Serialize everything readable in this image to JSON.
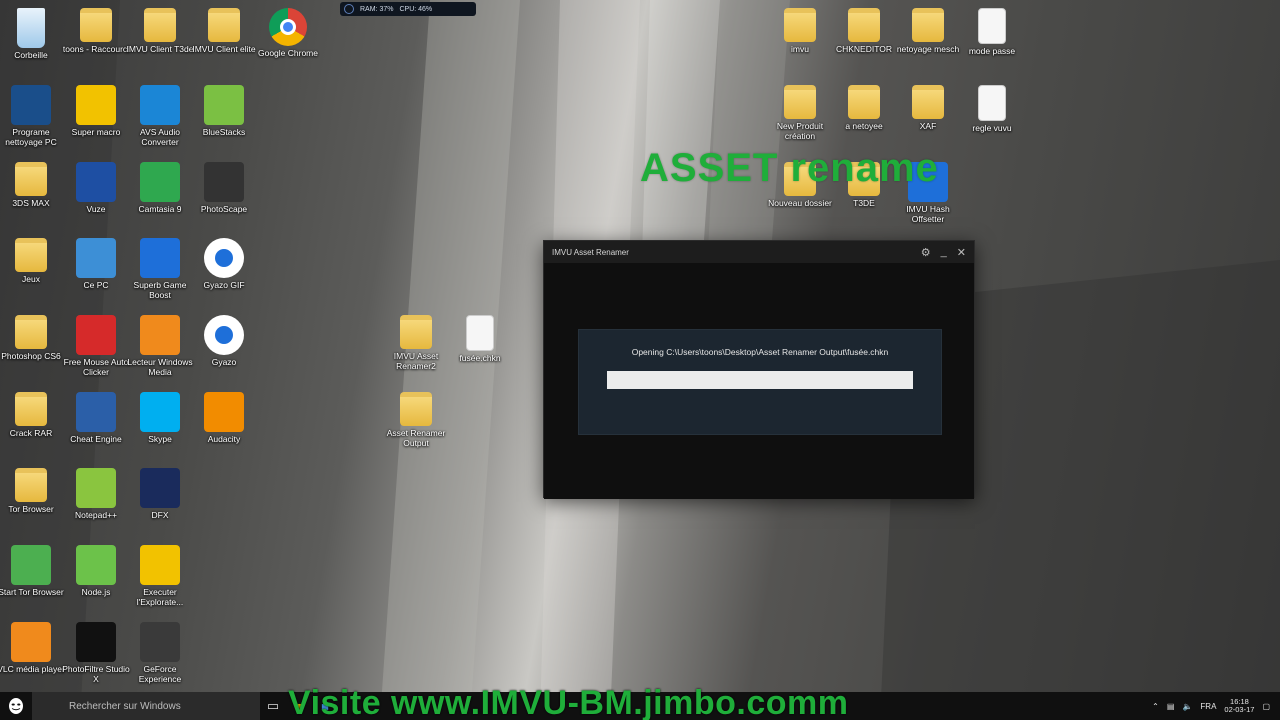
{
  "desktop_icons": [
    {
      "label": "Corbeille",
      "icon": "recycle-bin-icon",
      "type": "bin",
      "color": "#8fc7ee"
    },
    {
      "label": "toons - Raccourci",
      "icon": "folder-shortcut-icon",
      "type": "folder"
    },
    {
      "label": "IMVU Client T3de",
      "icon": "folder-icon",
      "type": "folder"
    },
    {
      "label": "IMVU Client elite",
      "icon": "folder-icon",
      "type": "folder"
    },
    {
      "label": "Google Chrome",
      "icon": "chrome-icon",
      "type": "chrome"
    },
    {
      "label": "Programe nettoyage PC",
      "icon": "cleaner-icon",
      "type": "app",
      "color": "#1a4e8a"
    },
    {
      "label": "Super macro",
      "icon": "macro-icon",
      "type": "app",
      "color": "#f2c200"
    },
    {
      "label": "AVS Audio Converter",
      "icon": "audio-converter-icon",
      "type": "app",
      "color": "#1b86d6"
    },
    {
      "label": "BlueStacks",
      "icon": "bluestacks-icon",
      "type": "app",
      "color": "#7bc043"
    },
    {
      "label": "3DS MAX",
      "icon": "3dsmax-icon",
      "type": "folder"
    },
    {
      "label": "Vuze",
      "icon": "vuze-icon",
      "type": "app",
      "color": "#1e4fa3"
    },
    {
      "label": "Camtasia 9",
      "icon": "camtasia-icon",
      "type": "app",
      "color": "#2fa84f"
    },
    {
      "label": "PhotoScape",
      "icon": "photoscape-icon",
      "type": "app",
      "color": "#333333"
    },
    {
      "label": "Jeux",
      "icon": "folder-icon",
      "type": "folder"
    },
    {
      "label": "Ce PC",
      "icon": "computer-icon",
      "type": "app",
      "color": "#3d8fd6"
    },
    {
      "label": "Superb Game Boost",
      "icon": "rocket-icon",
      "type": "app",
      "color": "#1e6fd9"
    },
    {
      "label": "Gyazo GIF",
      "icon": "gyazo-gif-icon",
      "type": "app",
      "color": "#ffffff"
    },
    {
      "label": "Photoshop CS6",
      "icon": "folder-icon",
      "type": "folder"
    },
    {
      "label": "Free Mouse Auto Clicker",
      "icon": "ruby-icon",
      "type": "app",
      "color": "#d62a2a"
    },
    {
      "label": "Lecteur Windows Media",
      "icon": "media-player-icon",
      "type": "app",
      "color": "#f08a1c"
    },
    {
      "label": "Gyazo",
      "icon": "gyazo-icon",
      "type": "app",
      "color": "#ffffff"
    },
    {
      "label": "Crack RAR",
      "icon": "folder-icon",
      "type": "folder"
    },
    {
      "label": "Cheat Engine",
      "icon": "cheat-engine-icon",
      "type": "app",
      "color": "#2b5fa8"
    },
    {
      "label": "Skype",
      "icon": "skype-icon",
      "type": "app",
      "color": "#00aff0"
    },
    {
      "label": "Audacity",
      "icon": "audacity-icon",
      "type": "app",
      "color": "#f28c00"
    },
    {
      "label": "Tor Browser",
      "icon": "tor-icon",
      "type": "folder"
    },
    {
      "label": "Notepad++",
      "icon": "notepad-plus-icon",
      "type": "app",
      "color": "#8ac53f"
    },
    {
      "label": "DFX",
      "icon": "dfx-icon",
      "type": "app",
      "color": "#1a2b5c"
    },
    {
      "label": "Start Tor Browser",
      "icon": "globe-icon",
      "type": "app",
      "color": "#4caf50"
    },
    {
      "label": "Node.js",
      "icon": "nodejs-icon",
      "type": "app",
      "color": "#6cc24a"
    },
    {
      "label": "Executer l'Explorate...",
      "icon": "explorer-icon",
      "type": "app",
      "color": "#f2c200"
    },
    {
      "label": "VLC média player",
      "icon": "vlc-icon",
      "type": "app",
      "color": "#f08a1c"
    },
    {
      "label": "PhotoFiltre Studio X",
      "icon": "photofiltre-icon",
      "type": "app",
      "color": "#111111"
    },
    {
      "label": "GeForce Experience",
      "icon": "geforce-icon",
      "type": "app",
      "color": "#3a3a3a"
    },
    {
      "label": "IMVU Asset Renamer2",
      "icon": "folder-icon",
      "type": "folder"
    },
    {
      "label": "fusée.chkn",
      "icon": "file-icon",
      "type": "doc"
    },
    {
      "label": "Asset Renamer Output",
      "icon": "folder-icon",
      "type": "folder"
    },
    {
      "label": "imvu",
      "icon": "folder-icon",
      "type": "folder"
    },
    {
      "label": "CHKNEDITOR",
      "icon": "folder-icon",
      "type": "folder"
    },
    {
      "label": "netoyage mesch",
      "icon": "folder-icon",
      "type": "folder"
    },
    {
      "label": "mode passe",
      "icon": "file-icon",
      "type": "doc"
    },
    {
      "label": "New Produit création",
      "icon": "folder-icon",
      "type": "folder"
    },
    {
      "label": "a netoyee",
      "icon": "folder-icon",
      "type": "folder"
    },
    {
      "label": "XAF",
      "icon": "folder-icon",
      "type": "folder"
    },
    {
      "label": "regle vuvu",
      "icon": "file-icon",
      "type": "doc"
    },
    {
      "label": "Nouveau dossier",
      "icon": "folder-icon",
      "type": "folder"
    },
    {
      "label": "T3DE",
      "icon": "folder-icon",
      "type": "folder"
    },
    {
      "label": "IMVU Hash Offsetter",
      "icon": "hash-offsetter-icon",
      "type": "app",
      "color": "#1e6fd9"
    }
  ],
  "widget": {
    "ram": "RAM: 37%",
    "cpu": "CPU: 46%"
  },
  "overlay": {
    "title": "ASSET rename",
    "banner": "Visite www.IMVU-BM.jimbo.comm",
    "title_color": "#1fae3a"
  },
  "app_window": {
    "title": "IMVU Asset Renamer",
    "modal_text": "Opening C:\\Users\\toons\\Desktop\\Asset Renamer Output\\fusée.chkn",
    "progress_fraction": 1.0
  },
  "taskbar": {
    "search_placeholder": "Rechercher sur Windows",
    "language": "FRA",
    "time": "16:18",
    "date": "02-03-17"
  }
}
